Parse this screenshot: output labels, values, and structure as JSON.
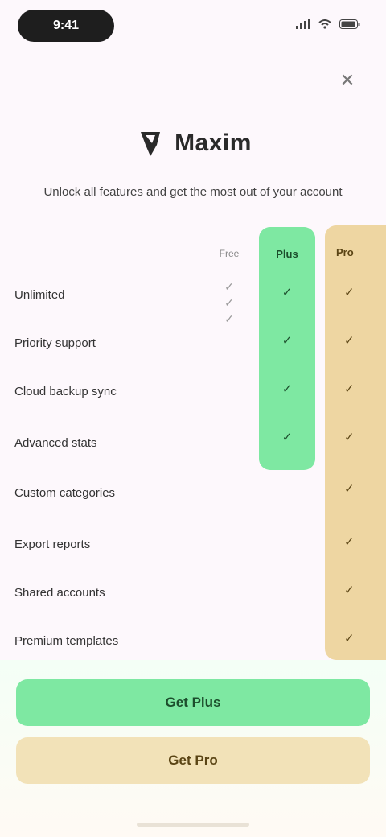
{
  "status_bar": {
    "time": "9:41",
    "icons": [
      "signal-icon",
      "wifi-icon",
      "battery-icon"
    ]
  },
  "header": {
    "close_icon": "close-icon",
    "brand_name": "Maxim",
    "brand_logo": "maxim-logo",
    "subtitle": "Unlock all features and get the most out of your account"
  },
  "plans": [
    {
      "label": "Free",
      "accent": "#fdf8fc"
    },
    {
      "label": "Plus",
      "accent": "#7ee8a2"
    },
    {
      "label": "Pro",
      "accent": "#eed6a2"
    }
  ],
  "features": [
    "Unlimited",
    "Priority support",
    "Cloud backup sync",
    "Advanced stats",
    "Custom categories",
    "Export reports",
    "Shared accounts",
    "Premium templates"
  ],
  "free_checks": [
    "✓",
    "✓",
    "✓"
  ],
  "plus_checks": [
    "✓",
    "✓",
    "✓",
    "✓"
  ],
  "pro_checks": [
    "✓",
    "✓",
    "✓",
    "✓",
    "✓",
    "✓",
    "✓",
    "✓"
  ],
  "buttons": {
    "primary": "Get Plus",
    "secondary": "Get Pro"
  },
  "colors": {
    "plus_green": "#7ee8a2",
    "pro_gold": "#eed6a2",
    "background": "#fdf8fc"
  }
}
